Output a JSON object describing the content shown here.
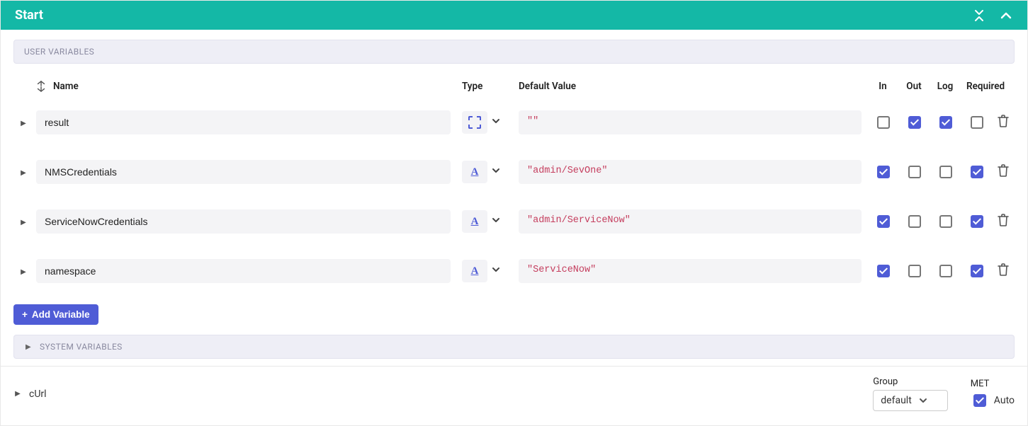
{
  "header": {
    "title": "Start"
  },
  "sections": {
    "user_variables_label": "USER VARIABLES",
    "system_variables_label": "SYSTEM VARIABLES"
  },
  "columns": {
    "name": "Name",
    "type": "Type",
    "default": "Default Value",
    "in": "In",
    "out": "Out",
    "log": "Log",
    "required": "Required"
  },
  "rows": [
    {
      "name": "result",
      "type_icon": "dash",
      "default": "\"\"",
      "in": false,
      "out": true,
      "log": true,
      "required": false
    },
    {
      "name": "NMSCredentials",
      "type_icon": "string",
      "default": "\"admin/SevOne\"",
      "in": true,
      "out": false,
      "log": false,
      "required": true
    },
    {
      "name": "ServiceNowCredentials",
      "type_icon": "string",
      "default": "\"admin/ServiceNow\"",
      "in": true,
      "out": false,
      "log": false,
      "required": true
    },
    {
      "name": "namespace",
      "type_icon": "string",
      "default": "\"ServiceNow\"",
      "in": true,
      "out": false,
      "log": false,
      "required": true
    }
  ],
  "add_button": "Add Variable",
  "footer": {
    "node_label": "cUrl",
    "group_label": "Group",
    "group_value": "default",
    "met_label": "MET",
    "met_auto_label": "Auto",
    "met_auto_checked": true
  }
}
